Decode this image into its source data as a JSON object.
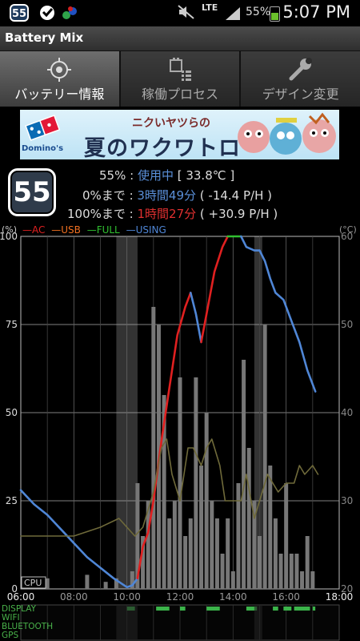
{
  "status_bar": {
    "badge": "55",
    "network": "LTE",
    "battery_percent": "55%",
    "time": "5:07 PM"
  },
  "app": {
    "title": "Battery Mix"
  },
  "tabs": [
    {
      "label": "バッテリー情報",
      "icon": "target-icon",
      "active": true
    },
    {
      "label": "稼働プロセス",
      "icon": "process-list-icon",
      "active": false
    },
    {
      "label": "デザイン変更",
      "icon": "wrench-icon",
      "active": false
    }
  ],
  "ad": {
    "brand": "Domino's",
    "subtitle": "ニクいヤツらの",
    "title": "夏のワクワトロ"
  },
  "battery": {
    "level": "55",
    "line1_pct": "55%",
    "line1_sep": " : ",
    "line1_status": "使用中",
    "line1_temp": " [ 33.8℃ ]",
    "line2_label": "0%まで",
    "line2_sep": " : ",
    "line2_time": "3時間49分",
    "line2_rate": " ( -14.4 P/H )",
    "line3_label": "100%まで",
    "line3_sep": " : ",
    "line3_time": "1時間27分",
    "line3_rate": " ( +30.9 P/H )"
  },
  "legend": {
    "left_unit": "(%)",
    "right_unit": "(°C)",
    "items": [
      {
        "name": "AC",
        "color": "#e02020"
      },
      {
        "name": "USB",
        "color": "#f07020"
      },
      {
        "name": "FULL",
        "color": "#30c030"
      },
      {
        "name": "USING",
        "color": "#4f86d6"
      }
    ]
  },
  "chart_data": {
    "type": "line",
    "x_ticks": [
      "06:00",
      "08:00",
      "10:00",
      "12:00",
      "14:00",
      "16:00",
      "18:00"
    ],
    "y_ticks_left": [
      "100",
      "75",
      "50",
      "25",
      "0"
    ],
    "y_ticks_right": [
      "60",
      "50",
      "40",
      "30",
      "20"
    ],
    "ylim": [
      0,
      100
    ],
    "y2lim": [
      20,
      60
    ],
    "cpu_label": "CPU",
    "series": [
      {
        "name": "USING",
        "color": "#4f86d6",
        "points": [
          [
            6.0,
            28
          ],
          [
            6.5,
            24
          ],
          [
            7.0,
            21
          ],
          [
            7.5,
            17
          ],
          [
            8.0,
            13
          ],
          [
            8.5,
            9
          ],
          [
            9.0,
            6
          ],
          [
            9.5,
            3
          ],
          [
            9.9,
            1
          ],
          [
            10.0,
            0.5
          ],
          [
            10.2,
            1
          ],
          [
            10.4,
            3
          ]
        ]
      },
      {
        "name": "AC",
        "color": "#e02020",
        "points": [
          [
            10.4,
            3
          ],
          [
            10.6,
            12
          ],
          [
            10.8,
            16
          ],
          [
            11.0,
            25
          ],
          [
            11.3,
            42
          ],
          [
            11.6,
            57
          ],
          [
            11.9,
            72
          ],
          [
            12.2,
            80
          ],
          [
            12.4,
            84
          ]
        ]
      },
      {
        "name": "USING",
        "color": "#4f86d6",
        "points": [
          [
            12.4,
            84
          ],
          [
            12.6,
            78
          ],
          [
            12.8,
            70
          ]
        ]
      },
      {
        "name": "AC",
        "color": "#e02020",
        "points": [
          [
            12.8,
            70
          ],
          [
            13.0,
            78
          ],
          [
            13.3,
            90
          ],
          [
            13.6,
            97
          ],
          [
            13.8,
            100
          ]
        ]
      },
      {
        "name": "FULL",
        "color": "#30c030",
        "points": [
          [
            13.8,
            100
          ],
          [
            14.3,
            100
          ]
        ]
      },
      {
        "name": "USING",
        "color": "#4f86d6",
        "points": [
          [
            14.3,
            100
          ],
          [
            14.5,
            97
          ],
          [
            14.8,
            96
          ],
          [
            15.0,
            96
          ],
          [
            15.2,
            93
          ],
          [
            15.4,
            88
          ],
          [
            15.6,
            84
          ],
          [
            15.9,
            82
          ],
          [
            16.2,
            76
          ],
          [
            16.5,
            70
          ],
          [
            16.8,
            62
          ],
          [
            17.1,
            56
          ]
        ]
      },
      {
        "name": "Temperature",
        "color": "#6f6a3a",
        "points": [
          [
            6.0,
            26
          ],
          [
            7.0,
            26
          ],
          [
            8.0,
            26
          ],
          [
            8.5,
            26.5
          ],
          [
            9.0,
            27
          ],
          [
            9.7,
            28
          ],
          [
            10.3,
            26
          ],
          [
            10.6,
            27
          ],
          [
            11.0,
            31
          ],
          [
            11.3,
            36
          ],
          [
            11.5,
            37
          ],
          [
            11.7,
            33
          ],
          [
            12.0,
            30
          ],
          [
            12.3,
            36
          ],
          [
            12.5,
            36
          ],
          [
            12.8,
            34
          ],
          [
            13.0,
            36
          ],
          [
            13.2,
            37
          ],
          [
            13.5,
            34
          ],
          [
            13.7,
            30
          ],
          [
            14.0,
            30
          ],
          [
            14.3,
            30
          ],
          [
            14.5,
            33
          ],
          [
            14.8,
            28
          ],
          [
            15.0,
            30
          ],
          [
            15.3,
            33
          ],
          [
            15.7,
            31
          ],
          [
            16.0,
            32
          ],
          [
            16.3,
            32
          ],
          [
            16.5,
            34
          ],
          [
            16.7,
            33
          ],
          [
            17.0,
            34
          ],
          [
            17.2,
            33
          ]
        ]
      }
    ],
    "cpu_bars": [
      [
        10.2,
        0.05
      ],
      [
        10.4,
        0.3
      ],
      [
        10.6,
        0.15
      ],
      [
        10.8,
        0.25
      ],
      [
        11.0,
        0.8
      ],
      [
        11.2,
        0.75
      ],
      [
        11.4,
        0.55
      ],
      [
        11.6,
        0.2
      ],
      [
        11.8,
        0.25
      ],
      [
        12.0,
        0.6
      ],
      [
        12.2,
        0.15
      ],
      [
        12.4,
        0.2
      ],
      [
        12.6,
        0.6
      ],
      [
        12.8,
        0.35
      ],
      [
        13.0,
        0.5
      ],
      [
        13.2,
        0.25
      ],
      [
        13.4,
        0.2
      ],
      [
        13.6,
        0.1
      ],
      [
        13.8,
        0.2
      ],
      [
        14.0,
        0.05
      ],
      [
        14.2,
        0.3
      ],
      [
        14.4,
        0.65
      ],
      [
        14.6,
        0.4
      ],
      [
        14.8,
        0.25
      ],
      [
        15.0,
        0.15
      ],
      [
        15.2,
        0.75
      ],
      [
        15.4,
        0.35
      ],
      [
        15.6,
        0.2
      ],
      [
        15.8,
        0.1
      ],
      [
        16.0,
        0.3
      ],
      [
        16.2,
        0.1
      ],
      [
        16.4,
        0.1
      ],
      [
        16.6,
        0.05
      ],
      [
        16.8,
        0.15
      ],
      [
        17.0,
        0.05
      ],
      [
        7.0,
        0.03
      ],
      [
        8.5,
        0.04
      ],
      [
        9.2,
        0.02
      ],
      [
        9.6,
        0.03
      ]
    ]
  },
  "activity_rows": [
    "DISPLAY",
    "WIFI",
    "BLUETOOTH",
    "GPS"
  ]
}
